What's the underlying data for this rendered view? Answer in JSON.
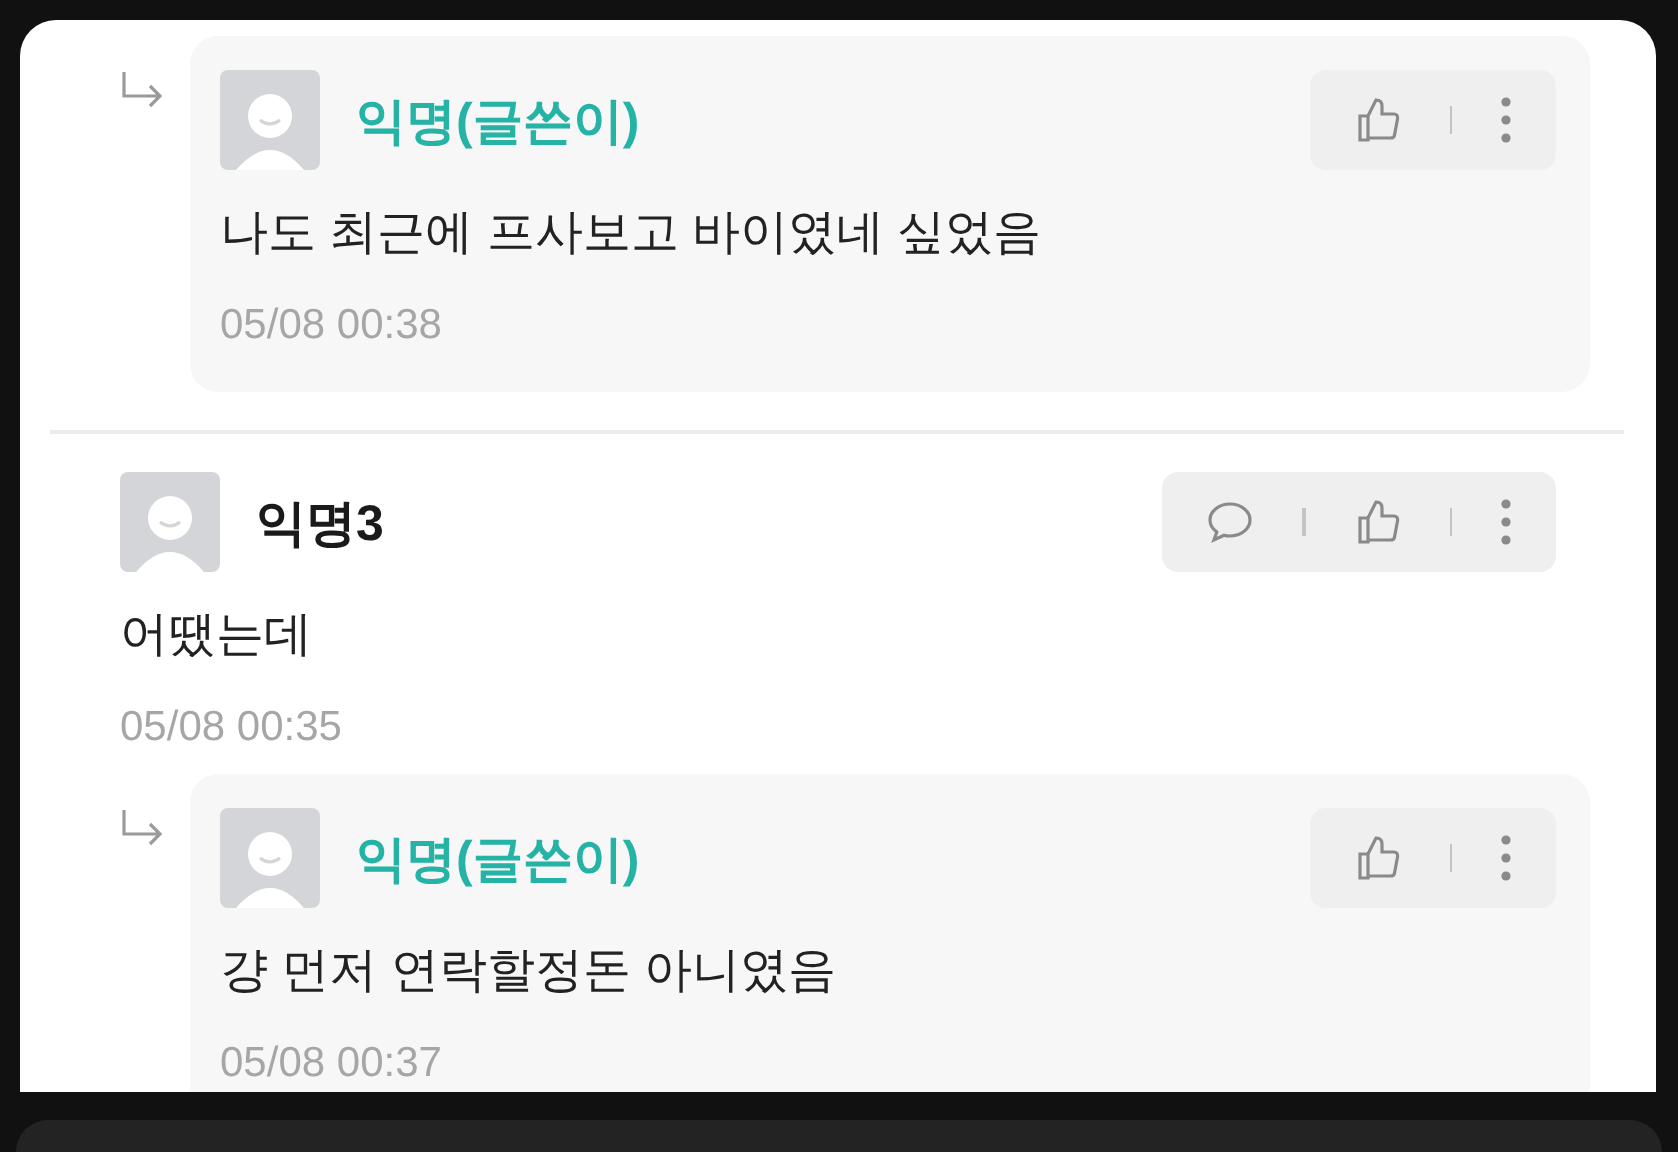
{
  "comments": [
    {
      "kind": "reply",
      "author": "익명(글쓴이)",
      "is_writer": true,
      "body": "나도 최근에 프사보고 바이였네 싶었음",
      "time": "05/08 00:38"
    },
    {
      "kind": "comment",
      "author": "익명3",
      "is_writer": false,
      "body": "어땠는데",
      "time": "05/08 00:35"
    },
    {
      "kind": "reply",
      "author": "익명(글쓴이)",
      "is_writer": true,
      "body": "걍 먼저 연락할정돈 아니였음",
      "time": "05/08 00:37"
    }
  ]
}
